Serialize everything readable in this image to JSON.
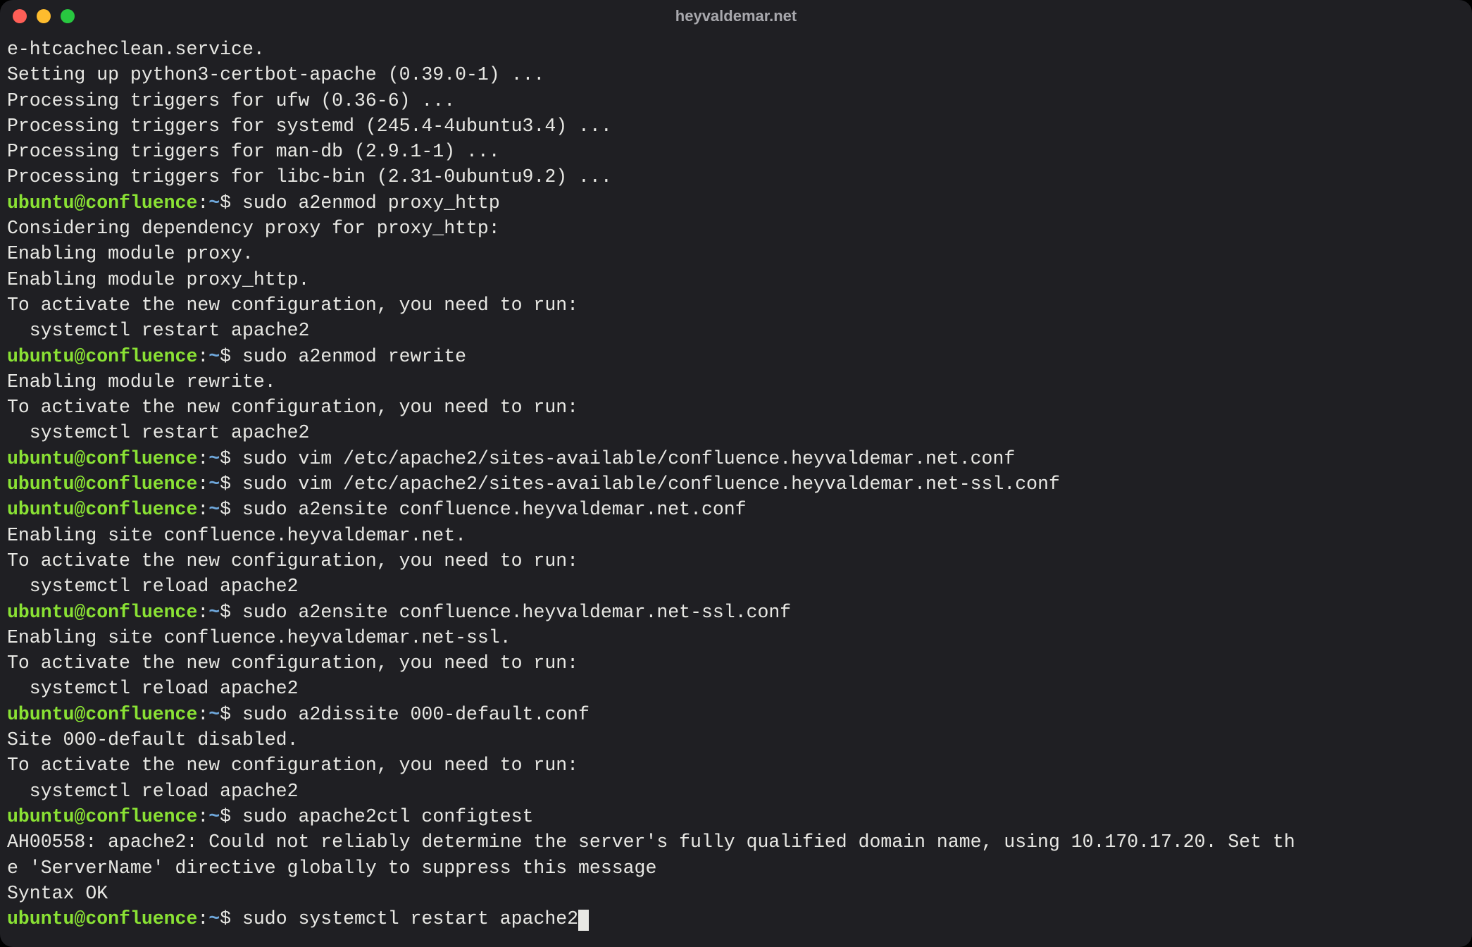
{
  "window": {
    "title": "heyvaldemar.net"
  },
  "colors": {
    "bg": "#1f1f23",
    "fg": "#e8e8e4",
    "promptUserHost": "#8ae234",
    "promptPath": "#6fa8dc",
    "trafficClose": "#ff5f57",
    "trafficMin": "#febc2e",
    "trafficMax": "#28c840"
  },
  "prompt": {
    "user": "ubuntu",
    "host": "confluence",
    "path": "~",
    "symbol": "$"
  },
  "lines": [
    {
      "type": "out",
      "text": "e-htcacheclean.service."
    },
    {
      "type": "out",
      "text": "Setting up python3-certbot-apache (0.39.0-1) ..."
    },
    {
      "type": "out",
      "text": "Processing triggers for ufw (0.36-6) ..."
    },
    {
      "type": "out",
      "text": "Processing triggers for systemd (245.4-4ubuntu3.4) ..."
    },
    {
      "type": "out",
      "text": "Processing triggers for man-db (2.9.1-1) ..."
    },
    {
      "type": "out",
      "text": "Processing triggers for libc-bin (2.31-0ubuntu9.2) ..."
    },
    {
      "type": "cmd",
      "text": "sudo a2enmod proxy_http"
    },
    {
      "type": "out",
      "text": "Considering dependency proxy for proxy_http:"
    },
    {
      "type": "out",
      "text": "Enabling module proxy."
    },
    {
      "type": "out",
      "text": "Enabling module proxy_http."
    },
    {
      "type": "out",
      "text": "To activate the new configuration, you need to run:"
    },
    {
      "type": "out",
      "text": "  systemctl restart apache2"
    },
    {
      "type": "cmd",
      "text": "sudo a2enmod rewrite"
    },
    {
      "type": "out",
      "text": "Enabling module rewrite."
    },
    {
      "type": "out",
      "text": "To activate the new configuration, you need to run:"
    },
    {
      "type": "out",
      "text": "  systemctl restart apache2"
    },
    {
      "type": "cmd",
      "text": "sudo vim /etc/apache2/sites-available/confluence.heyvaldemar.net.conf"
    },
    {
      "type": "cmd",
      "text": "sudo vim /etc/apache2/sites-available/confluence.heyvaldemar.net-ssl.conf"
    },
    {
      "type": "cmd",
      "text": "sudo a2ensite confluence.heyvaldemar.net.conf"
    },
    {
      "type": "out",
      "text": "Enabling site confluence.heyvaldemar.net."
    },
    {
      "type": "out",
      "text": "To activate the new configuration, you need to run:"
    },
    {
      "type": "out",
      "text": "  systemctl reload apache2"
    },
    {
      "type": "cmd",
      "text": "sudo a2ensite confluence.heyvaldemar.net-ssl.conf"
    },
    {
      "type": "out",
      "text": "Enabling site confluence.heyvaldemar.net-ssl."
    },
    {
      "type": "out",
      "text": "To activate the new configuration, you need to run:"
    },
    {
      "type": "out",
      "text": "  systemctl reload apache2"
    },
    {
      "type": "cmd",
      "text": "sudo a2dissite 000-default.conf"
    },
    {
      "type": "out",
      "text": "Site 000-default disabled."
    },
    {
      "type": "out",
      "text": "To activate the new configuration, you need to run:"
    },
    {
      "type": "out",
      "text": "  systemctl reload apache2"
    },
    {
      "type": "cmd",
      "text": "sudo apache2ctl configtest"
    },
    {
      "type": "out",
      "text": "AH00558: apache2: Could not reliably determine the server's fully qualified domain name, using 10.170.17.20. Set th"
    },
    {
      "type": "out",
      "text": "e 'ServerName' directive globally to suppress this message"
    },
    {
      "type": "out",
      "text": "Syntax OK"
    },
    {
      "type": "cmd",
      "text": "sudo systemctl restart apache2",
      "cursor": true
    }
  ]
}
